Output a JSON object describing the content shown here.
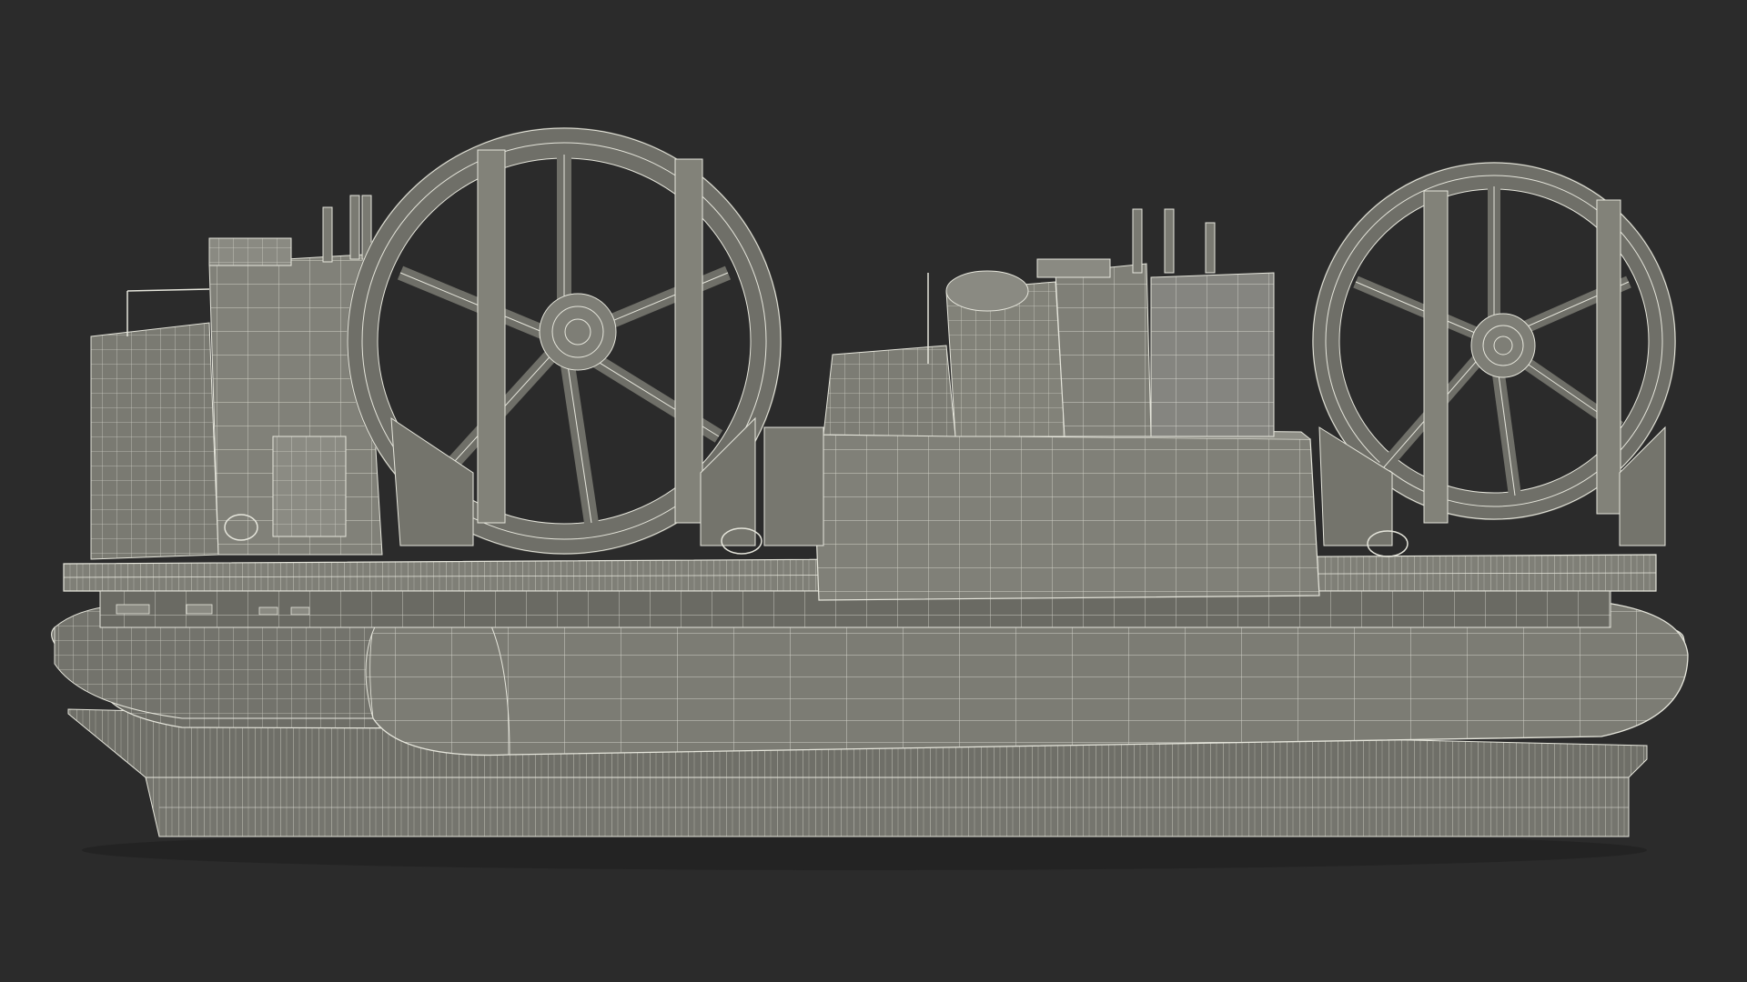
{
  "scene": {
    "subject": "hovercraft-wireframe-render",
    "colors": {
      "background": "#2b2b2b",
      "surface": "#7a7a72",
      "surface_light": "#8a8a82",
      "surface_dark": "#5e5e58",
      "wire": "#e6e6dc",
      "shadow": "#1a1a1a"
    }
  }
}
